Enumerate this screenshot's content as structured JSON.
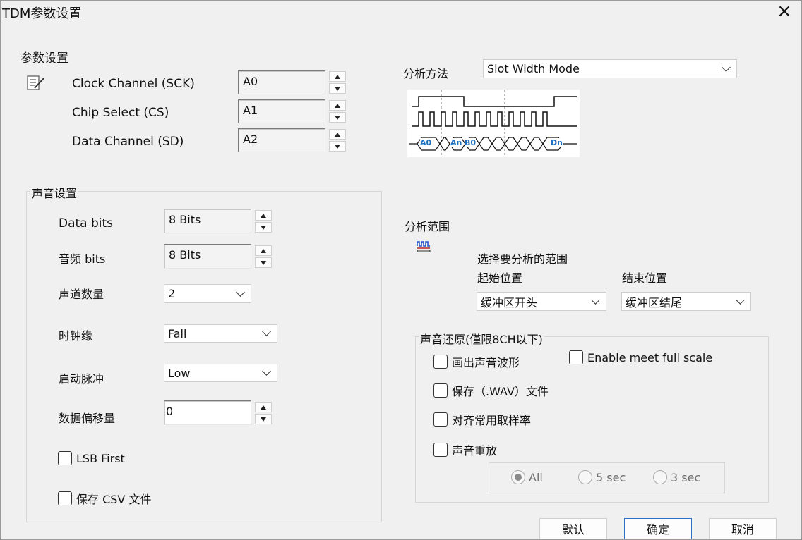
{
  "window": {
    "title": "TDM参数设置",
    "close_icon": "×"
  },
  "param_settings": {
    "heading": "参数设置",
    "icon": "edit-note-icon",
    "rows": [
      {
        "label": "Clock Channel (SCK)",
        "value": "A0"
      },
      {
        "label": "Chip Select (CS)",
        "value": "A1"
      },
      {
        "label": "Data Channel (SD)",
        "value": "A2"
      }
    ]
  },
  "audio_settings": {
    "heading": "声音设置",
    "data_bits": {
      "label": "Data bits",
      "value": "8 Bits"
    },
    "audio_bits": {
      "label": "音频 bits",
      "value": "8 Bits"
    },
    "channel_count": {
      "label": "声道数量",
      "value": "2"
    },
    "clock_edge": {
      "label": "时钟缘",
      "value": "Fall"
    },
    "start_pulse": {
      "label": "启动脉冲",
      "value": "Low"
    },
    "data_offset": {
      "label": "数据偏移量",
      "value": "0"
    },
    "lsb_first": {
      "label": "LSB First",
      "checked": false
    },
    "save_csv": {
      "label": "保存 CSV 文件",
      "checked": false
    }
  },
  "analysis_method": {
    "label": "分析方法",
    "value": "Slot Width Mode",
    "waveform_labels": [
      "A0",
      "An",
      "B0",
      "Dn"
    ]
  },
  "analysis_range": {
    "heading": "分析范围",
    "icon": "waveform-range-icon",
    "prompt": "选择要分析的范围",
    "start": {
      "label": "起始位置",
      "value": "缓冲区开头"
    },
    "end": {
      "label": "结束位置",
      "value": "缓冲区结尾"
    }
  },
  "audio_restore": {
    "heading": "声音还原(僅限8CH以下)",
    "draw_waveform": {
      "label": "画出声音波形",
      "checked": false
    },
    "enable_full_scale": {
      "label": "Enable meet full scale",
      "checked": false
    },
    "save_wav": {
      "label": "保存（.WAV）文件",
      "checked": false
    },
    "align_sample_rate": {
      "label": "对齐常用取样率",
      "checked": false
    },
    "replay": {
      "label": "声音重放",
      "checked": false
    },
    "replay_options": [
      {
        "label": "All",
        "selected": true
      },
      {
        "label": "5 sec",
        "selected": false
      },
      {
        "label": "3 sec",
        "selected": false
      }
    ]
  },
  "buttons": {
    "default": "默认",
    "ok": "确定",
    "cancel": "取消"
  },
  "colors": {
    "accent": "#2b6fc7",
    "waveform_label": "#1f6fbf"
  }
}
